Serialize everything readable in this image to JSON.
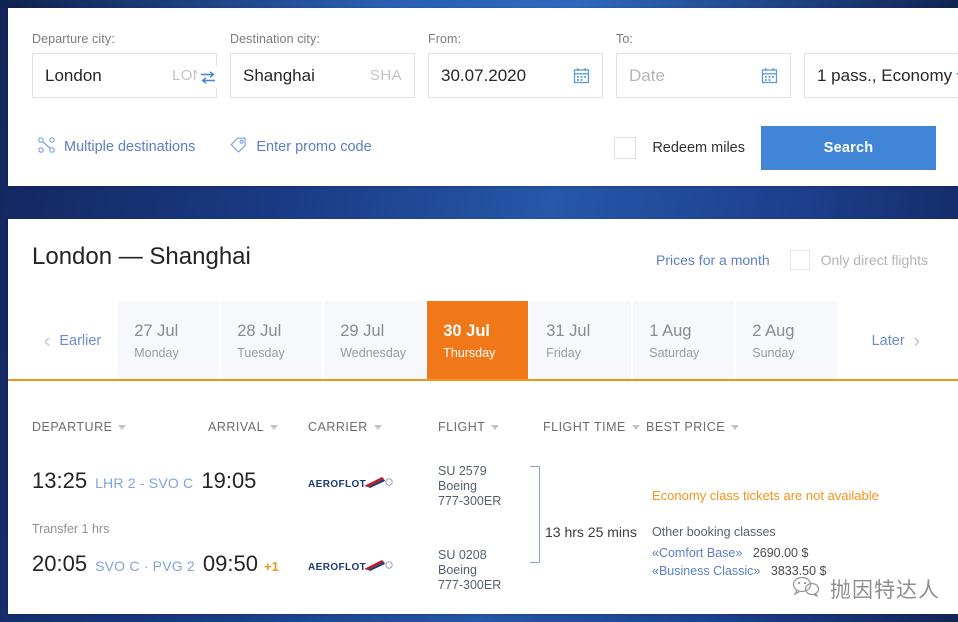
{
  "search": {
    "departure": {
      "label": "Departure city:",
      "value": "London",
      "code": "LON"
    },
    "destination": {
      "label": "Destination city:",
      "value": "Shanghai",
      "code": "SHA"
    },
    "from": {
      "label": "From:",
      "value": "30.07.2020"
    },
    "to": {
      "label": "To:",
      "placeholder": "Date"
    },
    "passengers": {
      "value": "1 pass., Economy"
    },
    "multiple_destinations": "Multiple destinations",
    "promo_code": "Enter promo code",
    "redeem_miles": "Redeem miles",
    "search_button": "Search",
    "icons": {
      "swap": "swap-arrows-icon",
      "calendar": "calendar-icon",
      "dropdown": "chevron-down-icon",
      "multi": "multiple-destinations-icon",
      "promo": "promo-tag-icon"
    }
  },
  "results": {
    "route_title": "London — Shanghai",
    "prices_for_month": "Prices for a month",
    "only_direct": "Only direct flights",
    "earlier": "Earlier",
    "later": "Later",
    "days": [
      {
        "date": "27 Jul",
        "weekday": "Monday",
        "active": false
      },
      {
        "date": "28 Jul",
        "weekday": "Tuesday",
        "active": false
      },
      {
        "date": "29 Jul",
        "weekday": "Wednesday",
        "active": false
      },
      {
        "date": "30 Jul",
        "weekday": "Thursday",
        "active": true
      },
      {
        "date": "31 Jul",
        "weekday": "Friday",
        "active": false
      },
      {
        "date": "1 Aug",
        "weekday": "Saturday",
        "active": false
      },
      {
        "date": "2 Aug",
        "weekday": "Sunday",
        "active": false
      }
    ],
    "columns": [
      "DEPARTURE",
      "ARRIVAL",
      "CARRIER",
      "FLIGHT",
      "FLIGHT TIME",
      "BEST PRICE"
    ],
    "itinerary": {
      "segments": [
        {
          "depart_time": "13:25",
          "ports": "LHR 2 - SVO C",
          "arrive_time": "19:05",
          "plus_days": "",
          "carrier": "AEROFLOT",
          "flight_number": "SU 2579",
          "aircraft": "Boeing 777-300ER"
        },
        {
          "depart_time": "20:05",
          "ports": "SVO C · PVG 2",
          "arrive_time": "09:50",
          "plus_days": "+1",
          "carrier": "AEROFLOT",
          "flight_number": "SU 0208",
          "aircraft": "Boeing 777-300ER"
        }
      ],
      "transfer": "Transfer 1 hrs",
      "total_flight_time": "13 hrs 25 mins",
      "price": {
        "unavailable_note": "Economy class tickets are not available",
        "other_classes_label": "Other booking classes",
        "classes": [
          {
            "name": "«Comfort Base»",
            "price": "2690.00 $"
          },
          {
            "name": "«Business Classic»",
            "price": "3833.50 $"
          }
        ]
      }
    }
  },
  "watermark": {
    "text": "抛因特达人",
    "icon": "wechat-bubble-icon"
  },
  "colors": {
    "accent_blue": "#4186d6",
    "link_blue": "#5b7fc7",
    "active_orange": "#f07818",
    "rule_orange": "#f0951b"
  }
}
